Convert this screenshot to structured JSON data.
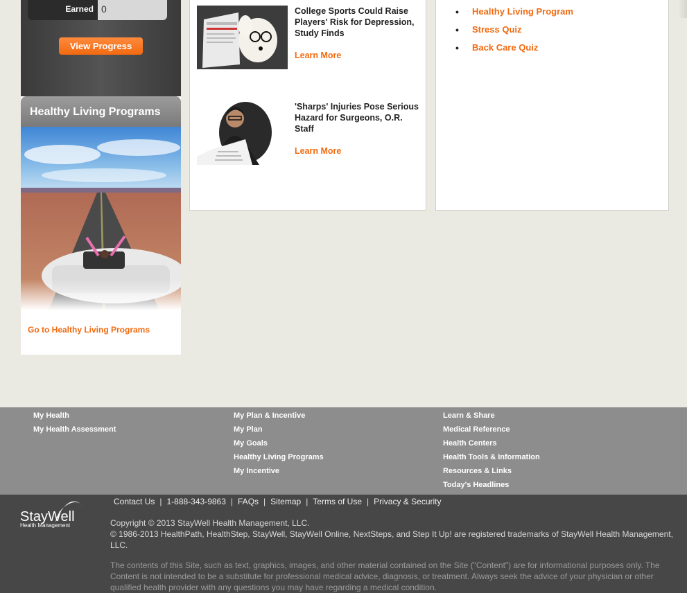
{
  "progress": {
    "earned_label": "Earned",
    "earned_value": "0",
    "view_progress_label": "View Progress"
  },
  "healthy_living": {
    "header": "Healthy Living Programs",
    "link": "Go to Healthy Living Programs"
  },
  "news": [
    {
      "title": "College Sports Could Raise Players' Risk for Depression, Study Finds",
      "learn_more": "Learn More"
    },
    {
      "title": "'Sharps' Injuries Pose Serious Hazard for Surgeons, O.R. Staff",
      "learn_more": "Learn More"
    }
  ],
  "links": [
    "Healthy Living Program",
    "Stress Quiz",
    "Back Care Quiz"
  ],
  "footer_nav": {
    "col1": [
      "My Health",
      "My Health Assessment"
    ],
    "col2": [
      "My Plan & Incentive",
      "My Plan",
      "My Goals",
      "Healthy Living Programs",
      "My Incentive"
    ],
    "col3": [
      "Learn & Share",
      "Medical Reference",
      "Health Centers",
      "Health Tools & Information",
      "Resources & Links",
      "Today's Headlines"
    ]
  },
  "footer": {
    "logo_text": "StayWell",
    "logo_sub": "Health Management",
    "contact": "Contact Us",
    "phone": "1-888-343-9863",
    "faqs": "FAQs",
    "sitemap": "Sitemap",
    "terms": "Terms of Use",
    "privacy": "Privacy & Security",
    "copyright_1": "Copyright © 2013 StayWell Health Management, LLC.",
    "copyright_2": "© 1986-2013 HealthPath, HealthStep, StayWell, StayWell Online, NextSteps, and Step It Up! are registered trademarks of StayWell Health Management, LLC.",
    "disclaimer": "The contents of this Site, such as text, graphics, images, and other material contained on the Site (\"Content\") are for informational purposes only. The Content is not intended to be a substitute for professional medical advice, diagnosis, or treatment. Always seek the advice of your physician or other qualified health provider with any questions you may have regarding a medical condition."
  },
  "colors": {
    "accent": "#f26a10",
    "page_bg": "#eae9e2",
    "nav_bg": "#8d8d8d",
    "footer_bg": "#474747"
  }
}
